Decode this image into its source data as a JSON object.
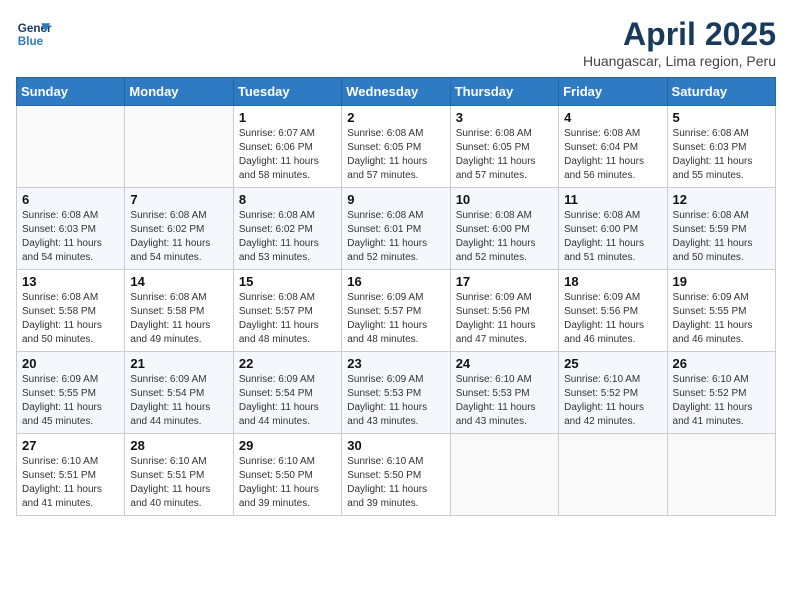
{
  "logo": {
    "line1": "General",
    "line2": "Blue"
  },
  "title": "April 2025",
  "subtitle": "Huangascar, Lima region, Peru",
  "days_of_week": [
    "Sunday",
    "Monday",
    "Tuesday",
    "Wednesday",
    "Thursday",
    "Friday",
    "Saturday"
  ],
  "weeks": [
    [
      {
        "day": "",
        "info": ""
      },
      {
        "day": "",
        "info": ""
      },
      {
        "day": "1",
        "info": "Sunrise: 6:07 AM\nSunset: 6:06 PM\nDaylight: 11 hours and 58 minutes."
      },
      {
        "day": "2",
        "info": "Sunrise: 6:08 AM\nSunset: 6:05 PM\nDaylight: 11 hours and 57 minutes."
      },
      {
        "day": "3",
        "info": "Sunrise: 6:08 AM\nSunset: 6:05 PM\nDaylight: 11 hours and 57 minutes."
      },
      {
        "day": "4",
        "info": "Sunrise: 6:08 AM\nSunset: 6:04 PM\nDaylight: 11 hours and 56 minutes."
      },
      {
        "day": "5",
        "info": "Sunrise: 6:08 AM\nSunset: 6:03 PM\nDaylight: 11 hours and 55 minutes."
      }
    ],
    [
      {
        "day": "6",
        "info": "Sunrise: 6:08 AM\nSunset: 6:03 PM\nDaylight: 11 hours and 54 minutes."
      },
      {
        "day": "7",
        "info": "Sunrise: 6:08 AM\nSunset: 6:02 PM\nDaylight: 11 hours and 54 minutes."
      },
      {
        "day": "8",
        "info": "Sunrise: 6:08 AM\nSunset: 6:02 PM\nDaylight: 11 hours and 53 minutes."
      },
      {
        "day": "9",
        "info": "Sunrise: 6:08 AM\nSunset: 6:01 PM\nDaylight: 11 hours and 52 minutes."
      },
      {
        "day": "10",
        "info": "Sunrise: 6:08 AM\nSunset: 6:00 PM\nDaylight: 11 hours and 52 minutes."
      },
      {
        "day": "11",
        "info": "Sunrise: 6:08 AM\nSunset: 6:00 PM\nDaylight: 11 hours and 51 minutes."
      },
      {
        "day": "12",
        "info": "Sunrise: 6:08 AM\nSunset: 5:59 PM\nDaylight: 11 hours and 50 minutes."
      }
    ],
    [
      {
        "day": "13",
        "info": "Sunrise: 6:08 AM\nSunset: 5:58 PM\nDaylight: 11 hours and 50 minutes."
      },
      {
        "day": "14",
        "info": "Sunrise: 6:08 AM\nSunset: 5:58 PM\nDaylight: 11 hours and 49 minutes."
      },
      {
        "day": "15",
        "info": "Sunrise: 6:08 AM\nSunset: 5:57 PM\nDaylight: 11 hours and 48 minutes."
      },
      {
        "day": "16",
        "info": "Sunrise: 6:09 AM\nSunset: 5:57 PM\nDaylight: 11 hours and 48 minutes."
      },
      {
        "day": "17",
        "info": "Sunrise: 6:09 AM\nSunset: 5:56 PM\nDaylight: 11 hours and 47 minutes."
      },
      {
        "day": "18",
        "info": "Sunrise: 6:09 AM\nSunset: 5:56 PM\nDaylight: 11 hours and 46 minutes."
      },
      {
        "day": "19",
        "info": "Sunrise: 6:09 AM\nSunset: 5:55 PM\nDaylight: 11 hours and 46 minutes."
      }
    ],
    [
      {
        "day": "20",
        "info": "Sunrise: 6:09 AM\nSunset: 5:55 PM\nDaylight: 11 hours and 45 minutes."
      },
      {
        "day": "21",
        "info": "Sunrise: 6:09 AM\nSunset: 5:54 PM\nDaylight: 11 hours and 44 minutes."
      },
      {
        "day": "22",
        "info": "Sunrise: 6:09 AM\nSunset: 5:54 PM\nDaylight: 11 hours and 44 minutes."
      },
      {
        "day": "23",
        "info": "Sunrise: 6:09 AM\nSunset: 5:53 PM\nDaylight: 11 hours and 43 minutes."
      },
      {
        "day": "24",
        "info": "Sunrise: 6:10 AM\nSunset: 5:53 PM\nDaylight: 11 hours and 43 minutes."
      },
      {
        "day": "25",
        "info": "Sunrise: 6:10 AM\nSunset: 5:52 PM\nDaylight: 11 hours and 42 minutes."
      },
      {
        "day": "26",
        "info": "Sunrise: 6:10 AM\nSunset: 5:52 PM\nDaylight: 11 hours and 41 minutes."
      }
    ],
    [
      {
        "day": "27",
        "info": "Sunrise: 6:10 AM\nSunset: 5:51 PM\nDaylight: 11 hours and 41 minutes."
      },
      {
        "day": "28",
        "info": "Sunrise: 6:10 AM\nSunset: 5:51 PM\nDaylight: 11 hours and 40 minutes."
      },
      {
        "day": "29",
        "info": "Sunrise: 6:10 AM\nSunset: 5:50 PM\nDaylight: 11 hours and 39 minutes."
      },
      {
        "day": "30",
        "info": "Sunrise: 6:10 AM\nSunset: 5:50 PM\nDaylight: 11 hours and 39 minutes."
      },
      {
        "day": "",
        "info": ""
      },
      {
        "day": "",
        "info": ""
      },
      {
        "day": "",
        "info": ""
      }
    ]
  ]
}
